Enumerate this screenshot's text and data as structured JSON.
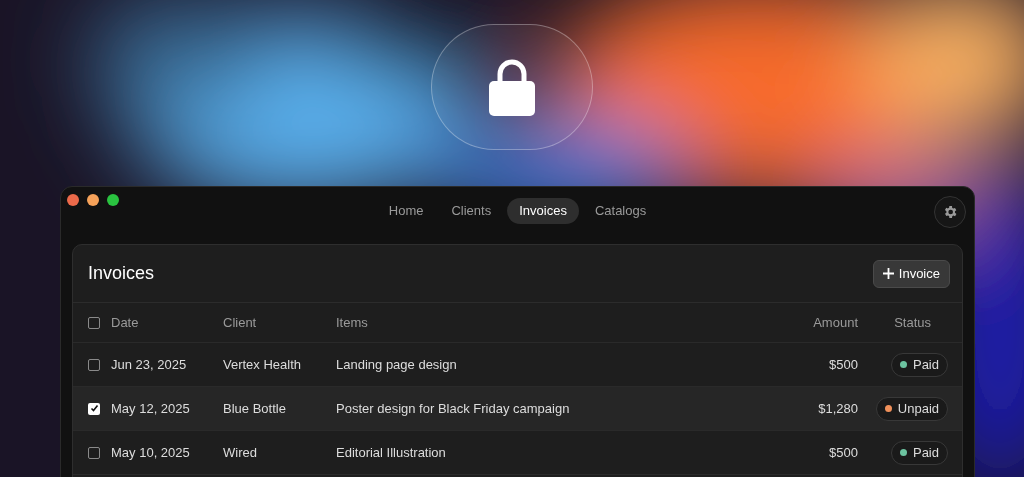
{
  "tabs": [
    {
      "label": "Home",
      "selected": false
    },
    {
      "label": "Clients",
      "selected": false
    },
    {
      "label": "Invoices",
      "selected": true
    },
    {
      "label": "Catalogs",
      "selected": false
    }
  ],
  "panel": {
    "title": "Invoices",
    "new_button": "Invoice"
  },
  "table": {
    "select_all": {
      "checked": false
    },
    "columns": [
      "Date",
      "Client",
      "Items",
      "Amount",
      "Status"
    ],
    "rows": [
      {
        "checked": false,
        "date": "Jun 23, 2025",
        "client": "Vertex Health",
        "items": "Landing page design",
        "amount": "$500",
        "status": "Paid",
        "color": "#6cc3a0"
      },
      {
        "checked": true,
        "date": "May 12, 2025",
        "client": "Blue Bottle",
        "items": "Poster design for Black Friday campaign",
        "amount": "$1,280",
        "status": "Unpaid",
        "color": "#f0905a"
      },
      {
        "checked": false,
        "date": "May 10, 2025",
        "client": "Wired",
        "items": "Editorial Illustration",
        "amount": "$500",
        "status": "Paid",
        "color": "#6cc3a0"
      }
    ]
  }
}
